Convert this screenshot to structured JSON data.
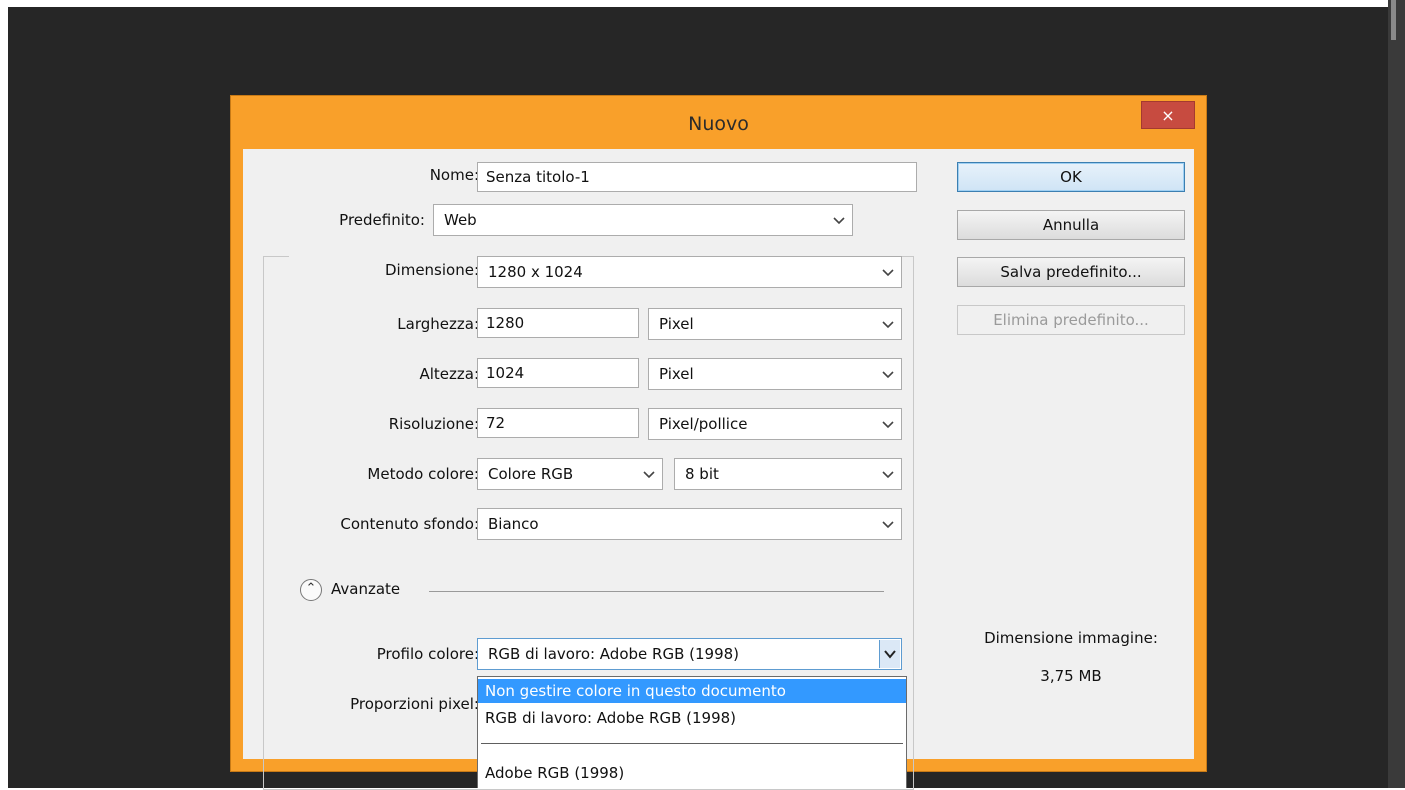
{
  "dialog": {
    "title": "Nuovo",
    "close": "×"
  },
  "form": {
    "nome_label": "Nome:",
    "nome_value": "Senza titolo-1",
    "predefinito_label": "Predefinito:",
    "predefinito_value": "Web",
    "dimensione_label": "Dimensione:",
    "dimensione_value": "1280 x 1024",
    "larghezza_label": "Larghezza:",
    "larghezza_value": "1280",
    "larghezza_unit": "Pixel",
    "altezza_label": "Altezza:",
    "altezza_value": "1024",
    "altezza_unit": "Pixel",
    "risoluzione_label": "Risoluzione:",
    "risoluzione_value": "72",
    "risoluzione_unit": "Pixel/pollice",
    "metodo_label": "Metodo colore:",
    "metodo_value": "Colore RGB",
    "bit_value": "8 bit",
    "sfondo_label": "Contenuto sfondo:",
    "sfondo_value": "Bianco",
    "avanzate_label": "Avanzate",
    "profilo_label": "Profilo colore:",
    "profilo_value": "RGB di lavoro:  Adobe RGB (1998)",
    "proporzioni_label": "Proporzioni pixel:"
  },
  "buttons": {
    "ok": "OK",
    "annulla": "Annulla",
    "salva": "Salva predefinito...",
    "elimina": "Elimina predefinito..."
  },
  "info": {
    "size_label": "Dimensione immagine:",
    "size_value": "3,75 MB"
  },
  "dropdown": {
    "options": [
      "Non gestire colore in questo documento",
      "RGB di lavoro:  Adobe RGB (1998)",
      "Adobe RGB (1998)"
    ],
    "selected_index": 0
  },
  "colors": {
    "title_bar": "#f9a02a",
    "close_button": "#c74b40",
    "highlight": "#3399ff",
    "app_background": "#262626"
  }
}
